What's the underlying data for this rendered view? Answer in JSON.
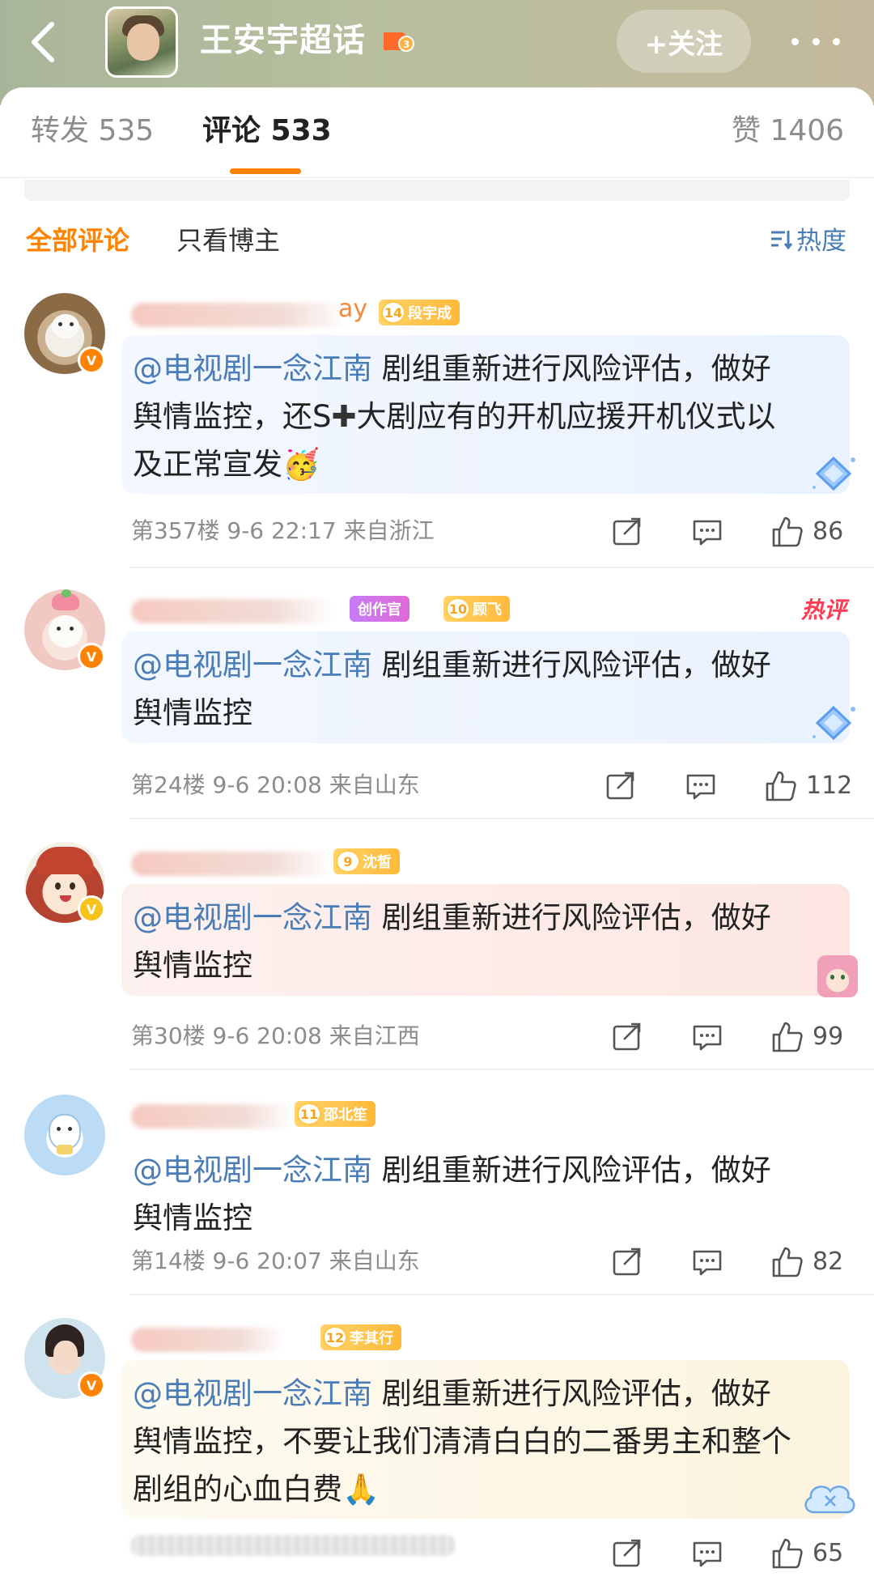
{
  "header": {
    "title": "王安宇超话",
    "follow_label": "+关注"
  },
  "tabs": [
    {
      "label": "转发 535"
    },
    {
      "label": "评论 533"
    },
    {
      "label": "赞 1406"
    }
  ],
  "filter": {
    "all": "全部评论",
    "author_only": "只看博主",
    "sort": "热度"
  },
  "comments": [
    {
      "name_suffix": "ay",
      "fan_level": "14",
      "fan_badge": "段宇成",
      "mention": "@电视剧一念江南",
      "text_1": " 剧组重新进行风险评估，做好",
      "text_2": "舆情监控，还S",
      "text_2b": "大剧应有的开机应援开机仪式以",
      "text_3": "及正常宣发🥳",
      "floor": "第357楼",
      "time": "9-6 22:17",
      "location": "来自浙江",
      "likes": "86"
    },
    {
      "creator_badge": "创作官",
      "fan_level": "10",
      "fan_badge": "顾飞",
      "hot_label": "热评",
      "mention": "@电视剧一念江南",
      "text_1": " 剧组重新进行风险评估，做好",
      "text_2": "舆情监控",
      "floor": "第24楼",
      "time": "9-6 20:08",
      "location": "来自山东",
      "likes": "112"
    },
    {
      "fan_level": "9",
      "fan_badge": "沈皙",
      "mention": "@电视剧一念江南",
      "text_1": " 剧组重新进行风险评估，做好",
      "text_2": "舆情监控",
      "floor": "第30楼",
      "time": "9-6 20:08",
      "location": "来自江西",
      "likes": "99"
    },
    {
      "fan_level": "11",
      "fan_badge": "邵北笙",
      "mention": "@电视剧一念江南",
      "text_1": " 剧组重新进行风险评估，做好",
      "text_2": "舆情监控",
      "floor": "第14楼",
      "time": "9-6 20:07",
      "location": "来自山东",
      "likes": "82"
    },
    {
      "fan_level": "12",
      "fan_badge": "李其行",
      "mention": "@电视剧一念江南",
      "text_1": " 剧组重新进行风险评估，做好",
      "text_2": "舆情监控，不要让我们清清白白的二番男主和整个",
      "text_3": "剧组的心血白费🙏",
      "likes": "65"
    }
  ],
  "colors": {
    "accent": "#ff8200",
    "link": "#4a7db8",
    "hot": "#ff3b52"
  }
}
